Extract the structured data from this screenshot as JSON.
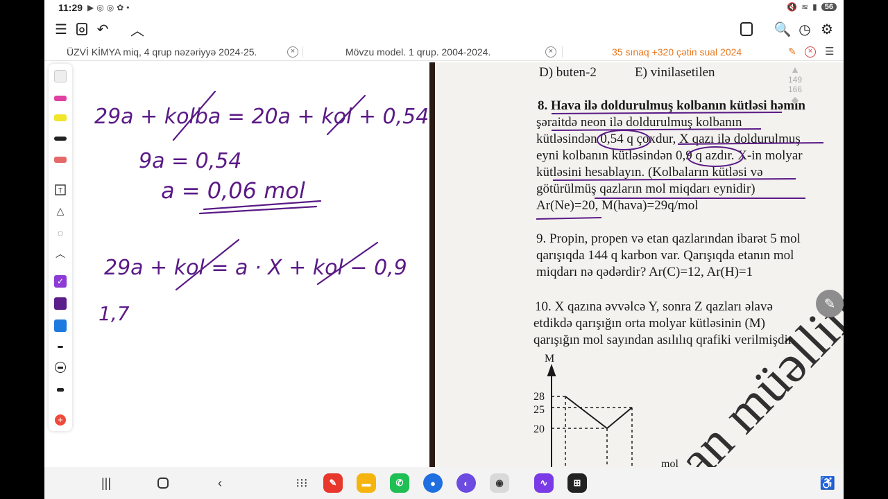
{
  "status_bar": {
    "time": "11:29",
    "battery": "56",
    "notification_icons": [
      "youtube-icon",
      "instagram-icon",
      "instagram-icon",
      "photos-icon"
    ],
    "system_icons": [
      "mute-icon",
      "wifi-icon",
      "signal-icon",
      "battery-icon"
    ]
  },
  "toolbar": {
    "left_icons": [
      "menu-icon",
      "read-mode-icon",
      "undo-icon",
      "collapse-icon"
    ],
    "right_icons": [
      "page-icon",
      "search-doc-icon",
      "history-icon",
      "settings-icon"
    ]
  },
  "tabs": [
    {
      "label": "ÜZVİ KİMYA miq, 4 qrup nəzəriyyə 2024-25.",
      "active": false
    },
    {
      "label": "Mövzu model. 1 qrup. 2004-2024.",
      "active": false
    },
    {
      "label": "35 sınaq +320 çətin sual 2024",
      "active": true
    }
  ],
  "tools": {
    "pen_colors": {
      "pink": "#e040a0",
      "yellow": "#f1e52a",
      "black": "#222222",
      "eraser_red": "#e46a6a"
    },
    "palette": [
      {
        "name": "purple-check",
        "color": "#8e3bd6"
      },
      {
        "name": "dark-purple",
        "color": "#5c1e8a"
      },
      {
        "name": "blue",
        "color": "#1f7ae0"
      }
    ]
  },
  "handwriting": {
    "ink_color": "#5a1a86",
    "line1": "29a + kolba = 20a + kol + 0,54",
    "line2": "9a = 0,54",
    "line3": "a = 0,06 mol",
    "line4": "29a + kol = a · X + kol − 0,9",
    "line5": "1,7"
  },
  "page_text": {
    "prev_answers": {
      "d": "D) buten-2",
      "e": "E) vinilasetilen"
    },
    "q8": {
      "l1": "8. Hava ilə doldurulmuş kolbanın kütləsi həmin",
      "l2": "şəraitdə neon ilə doldurulmuş kolbanın",
      "l3": "kütləsindən 0,54 q çoxdur, X qazı ilə doldurulmuş",
      "l4": "eyni kolbanın kütləsindən 0,9 q azdır. X-in molyar",
      "l5": "kütləsini hesablayın. (Kolbaların kütləsi və",
      "l6": "götürülmüş qazların mol miqdarı eynidir)",
      "l7": "Ar(Ne)=20, M(hava)=29q/mol"
    },
    "q9": {
      "l1": "9. Propin, propen və etan qazlarından ibarət 5 mol",
      "l2": "qarışıqda 144 q karbon var. Qarışıqda etanın mol",
      "l3": "miqdarı nə qədərdir? Ar(C)=12, Ar(H)=1"
    },
    "q10": {
      "l1": "10. X qazına əvvəlcə Y, sonra Z qazları əlavə",
      "l2": "etdikdə qarışığın orta molyar kütləsinin (M)",
      "l3": "qarışığın mol sayından asılılıq qrafiki verilmişdir."
    },
    "graph": {
      "y_axis": "M",
      "x_axis": "mol",
      "ticks": [
        "28",
        "25",
        "20"
      ]
    },
    "watermark": "man müəllim"
  },
  "scroll_indicator": {
    "current": "149",
    "total": "166"
  },
  "navbar": {
    "buttons": [
      "recents-icon",
      "home-icon",
      "back-icon"
    ],
    "apps": [
      {
        "name": "app-drawer-icon",
        "color": ""
      },
      {
        "name": "notes-app-icon",
        "color": "#e8372c"
      },
      {
        "name": "files-app-icon",
        "color": "#f6b40e"
      },
      {
        "name": "phone-app-icon",
        "color": "#1fbf55"
      },
      {
        "name": "messages-app-icon",
        "color": "#1f6fe0"
      },
      {
        "name": "browser-app-icon",
        "color": "#6b4be0"
      },
      {
        "name": "camera-app-icon",
        "color": "#d9d9d9"
      },
      {
        "name": "podcast-app-icon",
        "color": "#7a3be6"
      },
      {
        "name": "calculator-app-icon",
        "color": "#222222"
      }
    ],
    "accessibility": "accessibility-icon"
  }
}
